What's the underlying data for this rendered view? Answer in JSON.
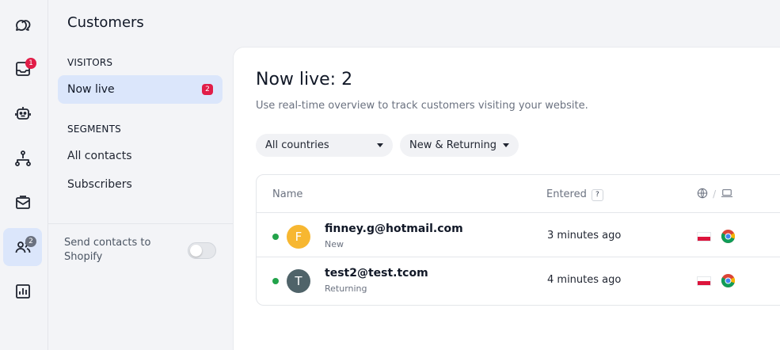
{
  "rail": {
    "inbox_badge": "1",
    "customers_badge": "2"
  },
  "sidebar": {
    "title": "Customers",
    "visitors_heading": "VISITORS",
    "now_live_label": "Now live",
    "now_live_badge": "2",
    "segments_heading": "SEGMENTS",
    "all_contacts_label": "All contacts",
    "subscribers_label": "Subscribers",
    "shopify_label": "Send contacts to Shopify"
  },
  "main": {
    "title": "Now live: 2",
    "subtitle": "Use real-time overview to track customers visiting your website.",
    "filter_country": "All countries",
    "filter_type": "New & Returning",
    "col_name": "Name",
    "col_entered": "Entered",
    "col_entered_help": "?",
    "rows": [
      {
        "initial": "F",
        "avatar_color": "#f7b731",
        "email": "finney.g@hotmail.com",
        "status": "New",
        "entered": "3 minutes ago"
      },
      {
        "initial": "T",
        "avatar_color": "#4f6369",
        "email": "test2@test.tcom",
        "status": "Returning",
        "entered": "4 minutes ago"
      }
    ]
  },
  "colors": {
    "accent_active_bg": "#dbe6fb",
    "badge_red": "#e11d48",
    "online_green": "#22a34a"
  },
  "icons": [
    "chat-bubbles-icon",
    "inbox-icon",
    "bot-icon",
    "flow-icon",
    "mail-icon",
    "customers-icon",
    "reports-icon",
    "globe-icon",
    "laptop-icon",
    "chrome-icon",
    "poland-flag-icon"
  ]
}
